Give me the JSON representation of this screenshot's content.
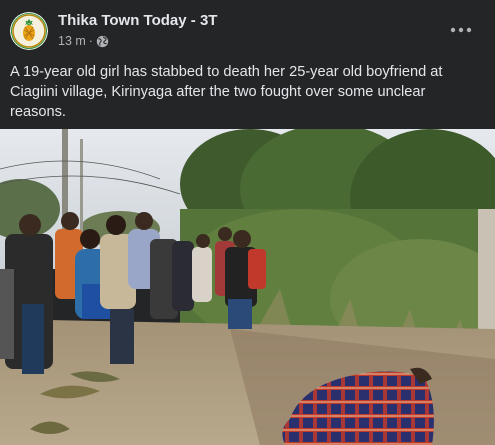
{
  "post": {
    "page_name": "Thika Town Today - 3T",
    "time": "13 m",
    "separator": "·",
    "audience_icon": "globe-icon",
    "more_icon": "more-options-icon",
    "caption": "A 19-year old girl has stabbed to death her 25-year old boyfriend at Ciagiini village, Kirinyaga after the two fought over some unclear reasons."
  },
  "colors": {
    "background": "#242526",
    "primary_text": "#e4e6eb",
    "secondary_text": "#b0b3b8"
  }
}
